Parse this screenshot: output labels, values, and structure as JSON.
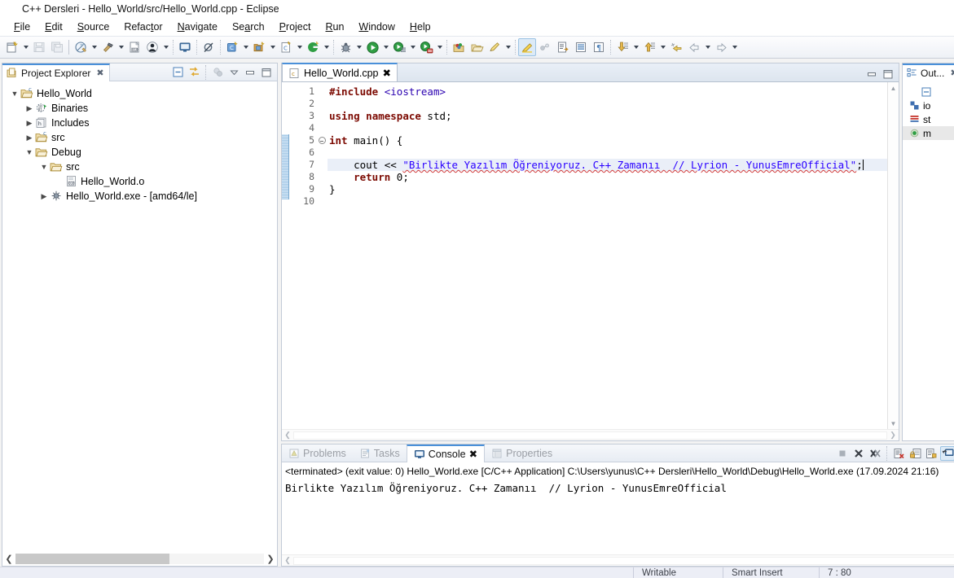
{
  "window": {
    "title": "C++ Dersleri - Hello_World/src/Hello_World.cpp - Eclipse",
    "app_icon": "eclipse-globe-icon"
  },
  "menubar": {
    "items": [
      {
        "label": "File",
        "mnemonic": "F"
      },
      {
        "label": "Edit",
        "mnemonic": "E"
      },
      {
        "label": "Source",
        "mnemonic": "S"
      },
      {
        "label": "Refactor",
        "mnemonic": "t"
      },
      {
        "label": "Navigate",
        "mnemonic": "N"
      },
      {
        "label": "Search",
        "mnemonic": "a"
      },
      {
        "label": "Project",
        "mnemonic": "P"
      },
      {
        "label": "Run",
        "mnemonic": "R"
      },
      {
        "label": "Window",
        "mnemonic": "W"
      },
      {
        "label": "Help",
        "mnemonic": "H"
      }
    ]
  },
  "toolbar": {
    "groups": [
      {
        "buttons": [
          {
            "name": "new-button",
            "icon": "new-file-icon",
            "dropdown": true
          },
          {
            "name": "save-button",
            "icon": "save-icon",
            "dropdown": false,
            "disabled": true
          },
          {
            "name": "save-all-button",
            "icon": "save-all-icon",
            "dropdown": false,
            "disabled": true
          }
        ]
      },
      {
        "buttons": [
          {
            "name": "build-all-button",
            "icon": "build-all-icon",
            "dropdown": true
          },
          {
            "name": "build-button",
            "icon": "hammer-build-icon",
            "dropdown": true
          },
          {
            "name": "new-c-source-file-button",
            "icon": "source-file-icon",
            "dropdown": false
          },
          {
            "name": "open-type-button",
            "icon": "person-icon",
            "dropdown": true
          }
        ]
      },
      {
        "buttons": [
          {
            "name": "console-toggle-button",
            "icon": "monitor-icon",
            "dropdown": false
          }
        ]
      },
      {
        "buttons": [
          {
            "name": "skip-breakpoints-button",
            "icon": "skip-breakpoints-icon",
            "dropdown": false
          }
        ]
      },
      {
        "buttons": [
          {
            "name": "new-c-class-button",
            "icon": "c-class-icon",
            "dropdown": true
          },
          {
            "name": "new-c-project-button",
            "icon": "c-project-icon",
            "dropdown": true
          },
          {
            "name": "new-c-file-button",
            "icon": "c-file-icon",
            "dropdown": true
          },
          {
            "name": "git-button",
            "icon": "git-icon",
            "dropdown": true
          }
        ]
      },
      {
        "buttons": [
          {
            "name": "debug-button",
            "icon": "bug-icon",
            "dropdown": true
          },
          {
            "name": "run-button",
            "icon": "run-green-play-icon",
            "dropdown": true
          },
          {
            "name": "run-last-tool-button",
            "icon": "external-tools-icon",
            "dropdown": true
          },
          {
            "name": "profile-button",
            "icon": "profile-icon",
            "dropdown": true
          }
        ]
      },
      {
        "buttons": [
          {
            "name": "open-element-button",
            "icon": "search-elements-icon",
            "dropdown": false
          },
          {
            "name": "open-resource-button",
            "icon": "open-folder-icon",
            "dropdown": false
          },
          {
            "name": "search-button",
            "icon": "pencil-search-icon",
            "dropdown": true
          }
        ]
      },
      {
        "buttons": [
          {
            "name": "toggle-mark-occurrences-button",
            "icon": "highlighter-icon",
            "dropdown": false,
            "selected": true
          },
          {
            "name": "toggle-block-selection-button",
            "icon": "link-editor-icon",
            "dropdown": false
          },
          {
            "name": "next-annotation-button",
            "icon": "annotation-next-icon",
            "dropdown": false
          },
          {
            "name": "show-whitespace-button",
            "icon": "show-source-icon",
            "dropdown": false
          },
          {
            "name": "show-pilcrow-button",
            "icon": "pilcrow-icon",
            "dropdown": false
          }
        ]
      },
      {
        "buttons": [
          {
            "name": "next-annotation-down-button",
            "icon": "arrow-down-annotation-icon",
            "dropdown": true
          },
          {
            "name": "previous-annotation-up-button",
            "icon": "arrow-up-annotation-icon",
            "dropdown": true
          }
        ]
      },
      {
        "buttons": [
          {
            "name": "last-edit-location-button",
            "icon": "last-edit-pointer-icon",
            "dropdown": false
          },
          {
            "name": "back-button",
            "icon": "arrow-left-icon",
            "dropdown": true
          },
          {
            "name": "forward-button",
            "icon": "arrow-right-icon",
            "dropdown": true
          }
        ]
      }
    ]
  },
  "project_explorer": {
    "title": "Project Explorer",
    "close_glyph": "✖",
    "toolbar": [
      {
        "name": "collapse-all-button",
        "icon": "collapse-all-icon"
      },
      {
        "name": "link-with-editor-button",
        "icon": "link-with-editor-icon"
      },
      {
        "name": "view-menu-filters-button",
        "icon": "filters-icon"
      },
      {
        "name": "view-menu-button",
        "icon": "chevron-down-icon"
      },
      {
        "name": "minimize-button",
        "icon": "minimize-icon"
      },
      {
        "name": "maximize-button",
        "icon": "maximize-icon"
      }
    ],
    "tree": [
      {
        "label": "Hello_World",
        "depth": 0,
        "expanded": true,
        "icon": "c-project-folder-icon"
      },
      {
        "label": "Binaries",
        "depth": 1,
        "expanded": false,
        "icon": "binaries-icon"
      },
      {
        "label": "Includes",
        "depth": 1,
        "expanded": false,
        "icon": "includes-icon"
      },
      {
        "label": "src",
        "depth": 1,
        "expanded": false,
        "icon": "source-folder-icon"
      },
      {
        "label": "Debug",
        "depth": 1,
        "expanded": true,
        "icon": "folder-icon"
      },
      {
        "label": "src",
        "depth": 2,
        "expanded": true,
        "icon": "folder-icon"
      },
      {
        "label": "Hello_World.o",
        "depth": 3,
        "expanded": null,
        "icon": "object-file-icon"
      },
      {
        "label": "Hello_World.exe - [amd64/le]",
        "depth": 2,
        "expanded": false,
        "icon": "executable-icon"
      }
    ]
  },
  "editor": {
    "tab": {
      "label": "Hello_World.cpp",
      "icon": "c-source-icon",
      "close_glyph": "✖"
    },
    "toolbar": [
      {
        "name": "editor-minimize-button",
        "icon": "minimize-icon"
      },
      {
        "name": "editor-maximize-button",
        "icon": "maximize-icon"
      }
    ],
    "line_numbers": [
      "1",
      "2",
      "3",
      "4",
      "5",
      "6",
      "7",
      "8",
      "9",
      "10"
    ],
    "folding_line": "5",
    "lines": [
      {
        "n": 1,
        "tokens": [
          {
            "t": "#include",
            "c": "pp"
          },
          {
            "t": " ",
            "c": "plain"
          },
          {
            "t": "<iostream>",
            "c": "inc"
          }
        ]
      },
      {
        "n": 2,
        "tokens": []
      },
      {
        "n": 3,
        "tokens": [
          {
            "t": "using",
            "c": "kw"
          },
          {
            "t": " ",
            "c": "plain"
          },
          {
            "t": "namespace",
            "c": "kw"
          },
          {
            "t": " std;",
            "c": "plain"
          }
        ]
      },
      {
        "n": 4,
        "tokens": []
      },
      {
        "n": 5,
        "tokens": [
          {
            "t": "int",
            "c": "kw"
          },
          {
            "t": " main() {",
            "c": "plain"
          }
        ]
      },
      {
        "n": 6,
        "tokens": []
      },
      {
        "n": 7,
        "highlight": true,
        "tokens": [
          {
            "t": "    cout << ",
            "c": "plain"
          },
          {
            "t": "\"Birlikte Yazılım Öğreniyoruz. C++ Zamanıı  // Lyrion - YunusEmreOfficial\"",
            "c": "str"
          },
          {
            "t": ";",
            "c": "plain"
          }
        ],
        "caret": true
      },
      {
        "n": 8,
        "tokens": [
          {
            "t": "    ",
            "c": "plain"
          },
          {
            "t": "return",
            "c": "kw"
          },
          {
            "t": " 0;",
            "c": "plain"
          }
        ]
      },
      {
        "n": 9,
        "tokens": [
          {
            "t": "}",
            "c": "plain"
          }
        ]
      },
      {
        "n": 10,
        "tokens": []
      }
    ]
  },
  "console": {
    "tabs": [
      {
        "label": "Problems",
        "icon": "problems-icon",
        "active": false
      },
      {
        "label": "Tasks",
        "icon": "tasks-icon",
        "active": false
      },
      {
        "label": "Console",
        "icon": "console-icon",
        "active": true,
        "close_glyph": "✖"
      },
      {
        "label": "Properties",
        "icon": "properties-icon",
        "active": false
      }
    ],
    "toolbar": [
      {
        "name": "terminate-button",
        "icon": "stop-square-icon"
      },
      {
        "name": "remove-launch-button",
        "icon": "remove-x-icon"
      },
      {
        "name": "remove-all-terminated-button",
        "icon": "remove-all-xx-icon"
      },
      {
        "name": "clear-console-button",
        "icon": "clear-console-icon"
      },
      {
        "name": "scroll-lock-button",
        "icon": "scroll-lock-icon"
      },
      {
        "name": "pin-console-button",
        "icon": "pin-console-icon"
      },
      {
        "name": "display-selected-console-button",
        "icon": "display-console-icon"
      }
    ],
    "terminated_line": "<terminated> (exit value: 0) Hello_World.exe [C/C++ Application] C:\\Users\\yunus\\C++ Dersleri\\Hello_World\\Debug\\Hello_World.exe (17.09.2024 21:16)",
    "output": "Birlikte Yazılım Öğreniyoruz. C++ Zamanıı  // Lyrion - YunusEmreOfficial"
  },
  "outline": {
    "title": "Out...",
    "close_glyph": "✖",
    "rows": [
      {
        "label": "io",
        "icon": "include-icon"
      },
      {
        "label": "st",
        "icon": "namespace-icon"
      },
      {
        "label": "m",
        "icon": "function-green-icon",
        "selected": true
      }
    ]
  },
  "statusbar": {
    "cells": [
      "",
      "Writable",
      "Smart Insert",
      "7 : 80"
    ]
  }
}
